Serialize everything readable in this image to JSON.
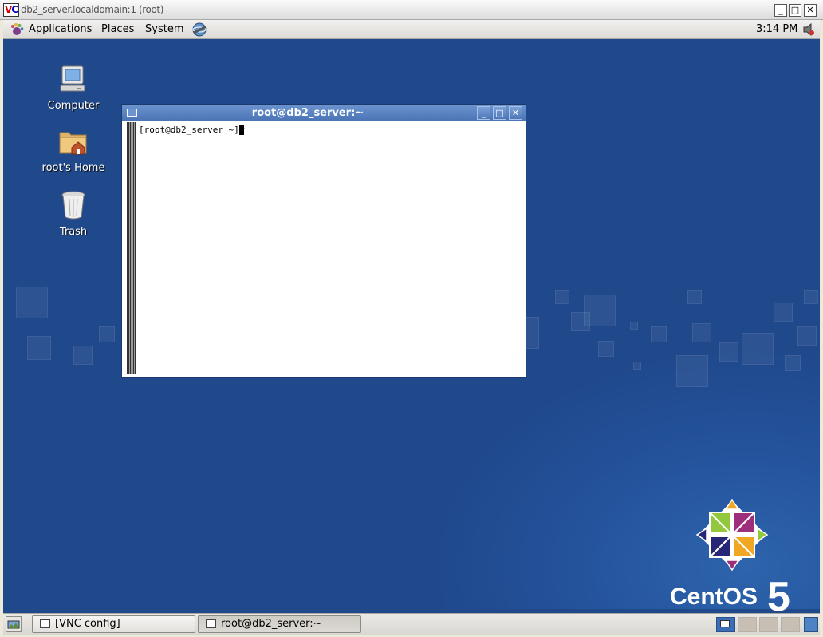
{
  "vnc_window": {
    "title": "db2_server.localdomain:1 (root)",
    "logo_text": "VC",
    "controls": [
      "_",
      "□",
      "✕"
    ]
  },
  "top_panel": {
    "menus": [
      "Applications",
      "Places",
      "System"
    ],
    "clock": "3:14 PM",
    "icons": [
      "gnome-foot-icon",
      "network-globe-icon",
      "volume-icon"
    ]
  },
  "desktop": {
    "icons": [
      {
        "label": "Computer",
        "icon": "computer-icon"
      },
      {
        "label": "root's Home",
        "icon": "home-folder-icon"
      },
      {
        "label": "Trash",
        "icon": "trash-icon"
      }
    ],
    "logo": {
      "text": "CentOS",
      "version": "5"
    }
  },
  "terminal": {
    "title": "root@db2_server:~",
    "prompt": "[root@db2_server ~]# ",
    "controls": [
      "minimize",
      "maximize",
      "close"
    ]
  },
  "taskbar": {
    "tasks": [
      {
        "label": "[VNC config]",
        "active": false
      },
      {
        "label": "root@db2_server:~",
        "active": true
      }
    ],
    "workspaces": 4,
    "current_workspace": 1
  },
  "colors": {
    "desktop_blue": "#20498c",
    "title_blue": "#4a73b5",
    "panel_gray": "#dcdad5"
  }
}
